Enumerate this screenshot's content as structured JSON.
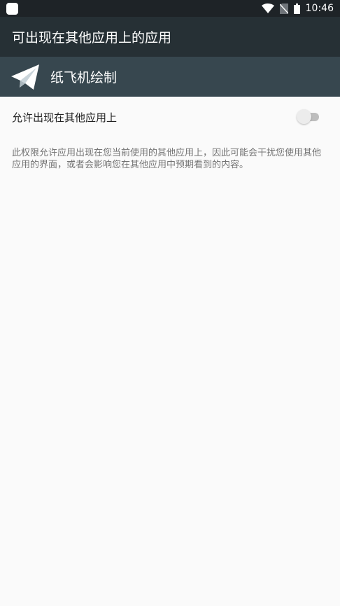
{
  "status_bar": {
    "time": "10:46",
    "icons": [
      "notification-icon",
      "wifi-icon",
      "no-sim-icon",
      "battery-icon"
    ]
  },
  "toolbar": {
    "title": "可出现在其他应用上的应用"
  },
  "app_header": {
    "app_name": "纸飞机绘制",
    "icon": "paper-plane-icon"
  },
  "preference": {
    "label": "允许出现在其他应用上",
    "enabled": false
  },
  "description": "此权限允许应用出现在您当前使用的其他应用上，因此可能会干扰您使用其他应用的界面，或者会影响您在其他应用中预期看到的内容。",
  "colors": {
    "status_bar": "#1e2327",
    "toolbar": "#263035",
    "app_header": "#37474f",
    "background": "#fafafa"
  }
}
